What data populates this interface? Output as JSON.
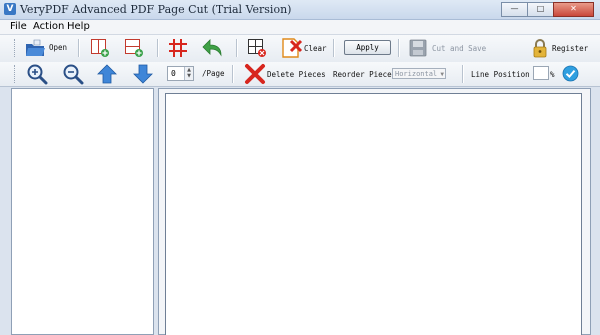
{
  "window": {
    "title": "VeryPDF Advanced PDF Page Cut (Trial Version)"
  },
  "menu": {
    "items": [
      "File",
      "Action",
      "Help"
    ]
  },
  "toolbar1": {
    "open_label": "Open",
    "clear_label": "Clear",
    "apply_label": "Apply",
    "cut_save_label": "Cut and Save",
    "register_label": "Register"
  },
  "toolbar2": {
    "page_value": "0",
    "page_suffix": "/Page",
    "delete_pieces_label": "Delete Pieces",
    "reorder_label": "Reorder Pieces:",
    "reorder_value": "Horizontal",
    "line_position_label": "Line Position :",
    "line_position_value": "",
    "percent_symbol": "%"
  },
  "colors": {
    "accent_blue": "#3a78c4",
    "red": "#d7261e",
    "green": "#3aa14a"
  }
}
